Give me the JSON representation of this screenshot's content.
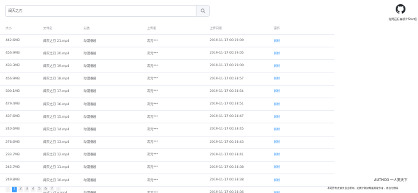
{
  "search": {
    "value": "闽灭之刃",
    "button_icon": "search-icon"
  },
  "header": {
    "github_icon": "github-icon",
    "star_text": "觉得还行麻烦个Star吧"
  },
  "table": {
    "columns": [
      "大小",
      "文件名",
      "分类",
      "上传者",
      "上传日期",
      "操作"
    ],
    "rows": [
      {
        "size": "442.6MB",
        "name": "闽灭之刃 21.mp4",
        "category": "动漫番剧",
        "uploader": "次元***",
        "date": "2019-11-17 00:39:09",
        "action": "解析"
      },
      {
        "size": "456.9MB",
        "name": "闽灭之刃 20.mp4",
        "category": "动漫番剧",
        "uploader": "次元***",
        "date": "2019-11-17 00:39:05",
        "action": "解析"
      },
      {
        "size": "433.3MB",
        "name": "闽灭之刃 19.mp4",
        "category": "动漫番剧",
        "uploader": "次元***",
        "date": "2019-11-17 00:39:00",
        "action": "解析"
      },
      {
        "size": "456.9MB",
        "name": "闽灭之刃 18.mp4",
        "category": "动漫番剧",
        "uploader": "次元***",
        "date": "2019-11-17 00:38:57",
        "action": "解析"
      },
      {
        "size": "500.1MB",
        "name": "闽灭之刃 17.mp4",
        "category": "动漫番剧",
        "uploader": "次元***",
        "date": "2019-11-17 00:38:54",
        "action": "解析"
      },
      {
        "size": "479.4MB",
        "name": "闽灭之刃 16.mp4",
        "category": "动漫番剧",
        "uploader": "次元***",
        "date": "2019-11-17 00:38:51",
        "action": "解析"
      },
      {
        "size": "437.6MB",
        "name": "闽灭之刃 15.mp4",
        "category": "动漫番剧",
        "uploader": "次元***",
        "date": "2019-11-17 00:38:47",
        "action": "解析"
      },
      {
        "size": "240.6MB",
        "name": "闽灭之刃 14.mp4",
        "category": "动漫番剧",
        "uploader": "次元***",
        "date": "2019-11-17 00:38:45",
        "action": "解析"
      },
      {
        "size": "278.6MB",
        "name": "闽灭之刃 13.mp4",
        "category": "动漫番剧",
        "uploader": "次元***",
        "date": "2019-11-17 00:38:43",
        "action": "解析"
      },
      {
        "size": "233.7MB",
        "name": "闽灭之刃 12.mp4",
        "category": "动漫番剧",
        "uploader": "次元***",
        "date": "2019-11-17 00:38:41",
        "action": "解析"
      },
      {
        "size": "245.7MB",
        "name": "闽灭之刃 11.mp4",
        "category": "动漫番剧",
        "uploader": "次元***",
        "date": "2019-11-17 00:38:38",
        "action": "解析"
      },
      {
        "size": "249.8MB",
        "name": "闽灭之刃 10.mp4",
        "category": "动漫番剧",
        "uploader": "次元***",
        "date": "2019-11-17 00:38:38",
        "action": "解析"
      },
      {
        "size": "",
        "name": "闽灭之刃 9.mp4",
        "category": "动漫番剧",
        "uploader": "次元***",
        "date": "2019-11-17 00:38:36",
        "action": "解析"
      }
    ]
  },
  "footer": {
    "author": "AUTHOR    一人笑天下",
    "disclaimer": "本站所有资源来自互联网，如需下载请尊重原版作者，请自行删除"
  },
  "pagination": {
    "prev": "‹",
    "pages": [
      "1",
      "2",
      "3",
      "4",
      "5",
      "6",
      "7"
    ],
    "current": "1",
    "next": "›"
  },
  "colors": {
    "accent": "#409eff",
    "border": "#ebeef5",
    "text": "#606266",
    "header_text": "#909399"
  }
}
